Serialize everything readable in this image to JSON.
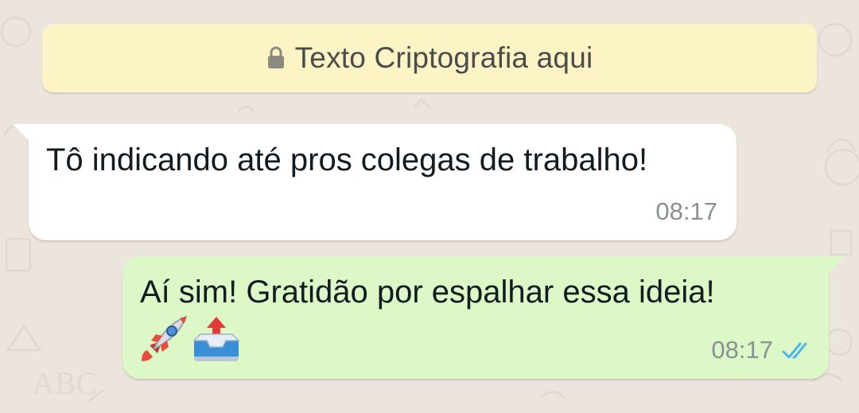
{
  "banner": {
    "text": "Texto Criptografia aqui",
    "icon": "lock-icon"
  },
  "messages": [
    {
      "direction": "incoming",
      "text": "Tô indicando até pros colegas de trabalho!",
      "time": "08:17"
    },
    {
      "direction": "outgoing",
      "text": "Aí sim! Gratidão por espalhar essa ideia!",
      "emojis": [
        "rocket-emoji",
        "outbox-tray-emoji"
      ],
      "time": "08:17",
      "status": "read",
      "status_icon": "double-check-icon"
    }
  ],
  "colors": {
    "background": "#ece5dd",
    "banner": "#fdf4c5",
    "incoming_bubble": "#ffffff",
    "outgoing_bubble": "#dcf8c6",
    "read_ticks": "#4fb6ec",
    "timestamp": "#8a9096"
  }
}
